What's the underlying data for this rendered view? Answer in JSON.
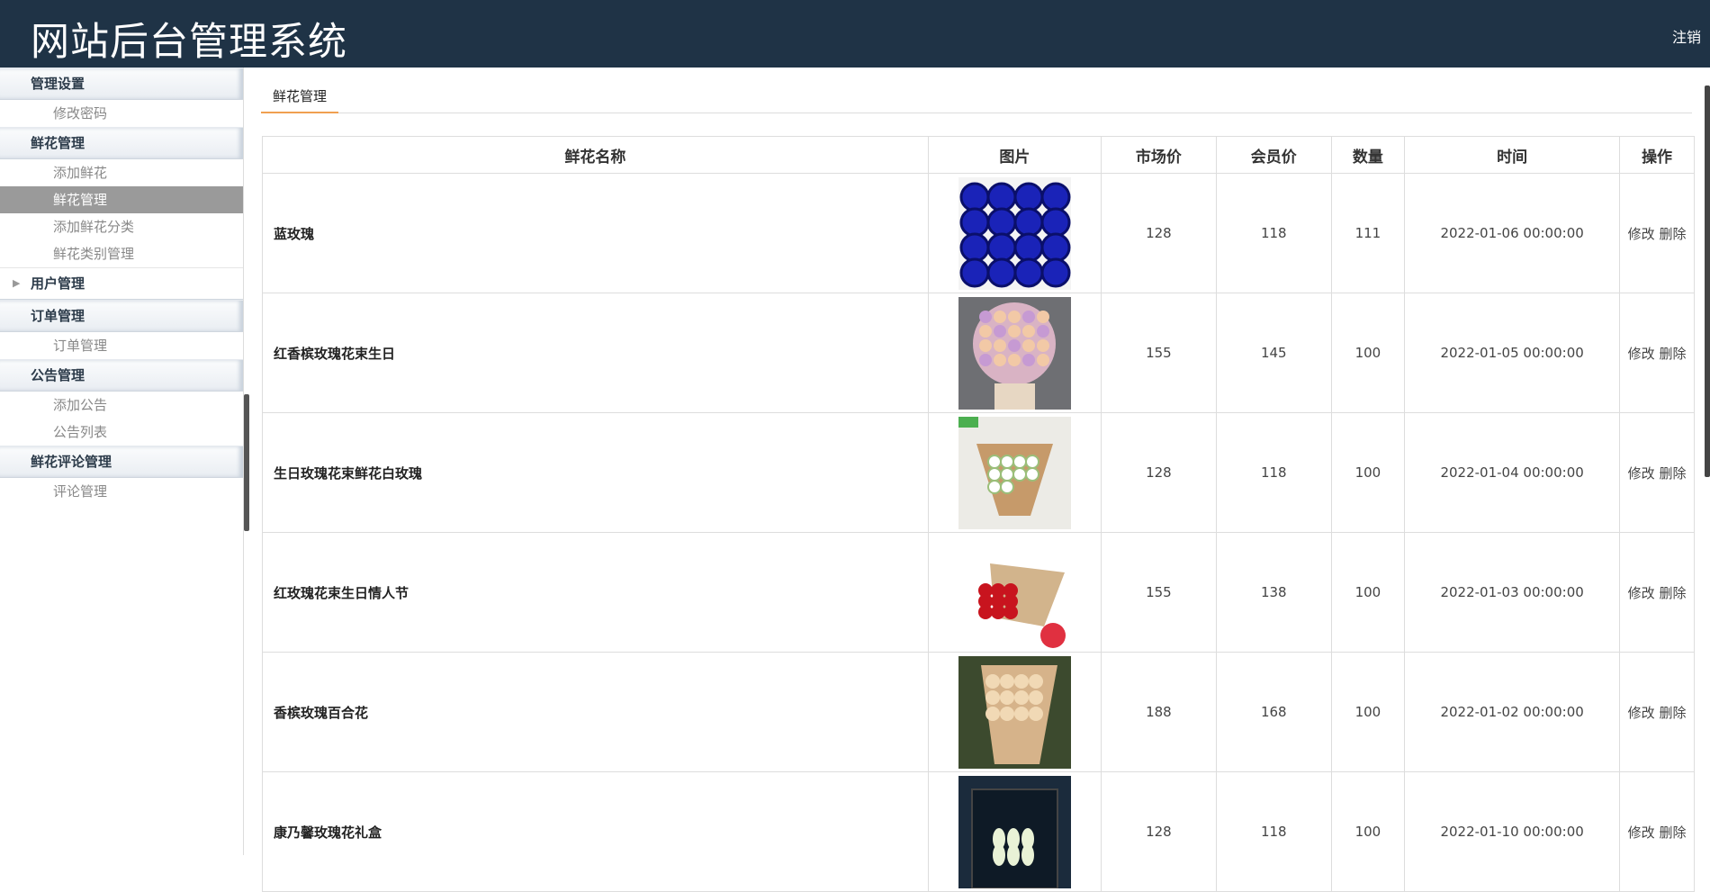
{
  "header": {
    "title": "网站后台管理系统",
    "logout": "注销"
  },
  "sidebar": {
    "groups": [
      {
        "title": "管理设置",
        "items": [
          "修改密码"
        ]
      },
      {
        "title": "鲜花管理",
        "items": [
          "添加鲜花",
          "鲜花管理",
          "添加鲜花分类",
          "鲜花类别管理"
        ]
      },
      {
        "title": "用户管理",
        "items": []
      },
      {
        "title": "订单管理",
        "items": [
          "订单管理"
        ]
      },
      {
        "title": "公告管理",
        "items": [
          "添加公告",
          "公告列表"
        ]
      },
      {
        "title": "鲜花评论管理",
        "items": [
          "评论管理"
        ]
      }
    ],
    "active_item": "鲜花管理"
  },
  "main": {
    "tab": "鲜花管理",
    "columns": [
      "鲜花名称",
      "图片",
      "市场价",
      "会员价",
      "数量",
      "时间",
      "操作"
    ],
    "rows": [
      {
        "name": "蓝玫瑰",
        "market": "128",
        "member": "118",
        "qty": "111",
        "time": "2022-01-06 00:00:00",
        "img": "blue"
      },
      {
        "name": "红香槟玫瑰花束生日",
        "market": "155",
        "member": "145",
        "qty": "100",
        "time": "2022-01-05 00:00:00",
        "img": "pink"
      },
      {
        "name": "生日玫瑰花束鲜花白玫瑰",
        "market": "128",
        "member": "118",
        "qty": "100",
        "time": "2022-01-04 00:00:00",
        "img": "white"
      },
      {
        "name": "红玫瑰花束生日情人节",
        "market": "155",
        "member": "138",
        "qty": "100",
        "time": "2022-01-03 00:00:00",
        "img": "red"
      },
      {
        "name": "香槟玫瑰百合花",
        "market": "188",
        "member": "168",
        "qty": "100",
        "time": "2022-01-02 00:00:00",
        "img": "champagne"
      },
      {
        "name": "康乃馨玫瑰花礼盒",
        "market": "128",
        "member": "118",
        "qty": "100",
        "time": "2022-01-10 00:00:00",
        "img": "lily"
      }
    ],
    "ops": {
      "edit": "修改",
      "delete": "删除"
    }
  }
}
